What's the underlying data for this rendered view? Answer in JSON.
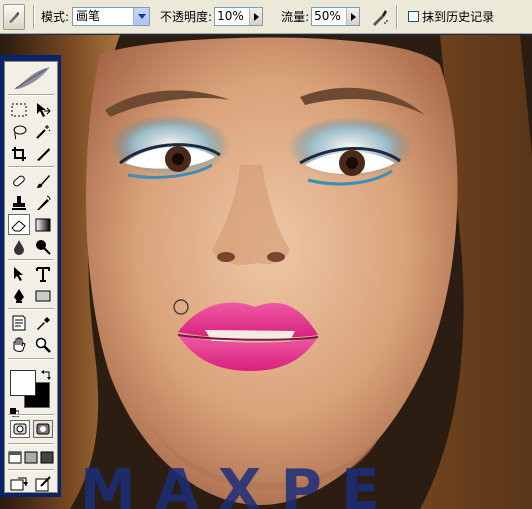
{
  "options_bar": {
    "mode_label": "模式:",
    "mode_value": "画笔",
    "opacity_label": "不透明度:",
    "opacity_value": "10%",
    "flow_label": "流量:",
    "flow_value": "50%",
    "history_label": "抹到历史记录",
    "history_checked": false
  },
  "toolbox": {
    "tools": [
      "marquee-tool",
      "move-tool",
      "lasso-tool",
      "magic-wand-tool",
      "crop-tool",
      "slice-tool",
      "healing-brush-tool",
      "brush-tool",
      "clone-stamp-tool",
      "history-brush-tool",
      "eraser-tool",
      "gradient-tool",
      "blur-tool",
      "dodge-tool",
      "path-selection-tool",
      "type-tool",
      "pen-tool",
      "shape-tool",
      "notes-tool",
      "eyedropper-tool",
      "hand-tool",
      "zoom-tool"
    ],
    "active_tool": "eraser-tool",
    "foreground_color": "#ffffff",
    "background_color": "#000000"
  },
  "colors": {
    "titlebar_blue": "#0a246a",
    "panel_bg": "#ece9d8",
    "lip_pink": "#e8348a",
    "eyeshadow_blue": "#3a8fb8",
    "hair_brown": "#7a4a22"
  }
}
